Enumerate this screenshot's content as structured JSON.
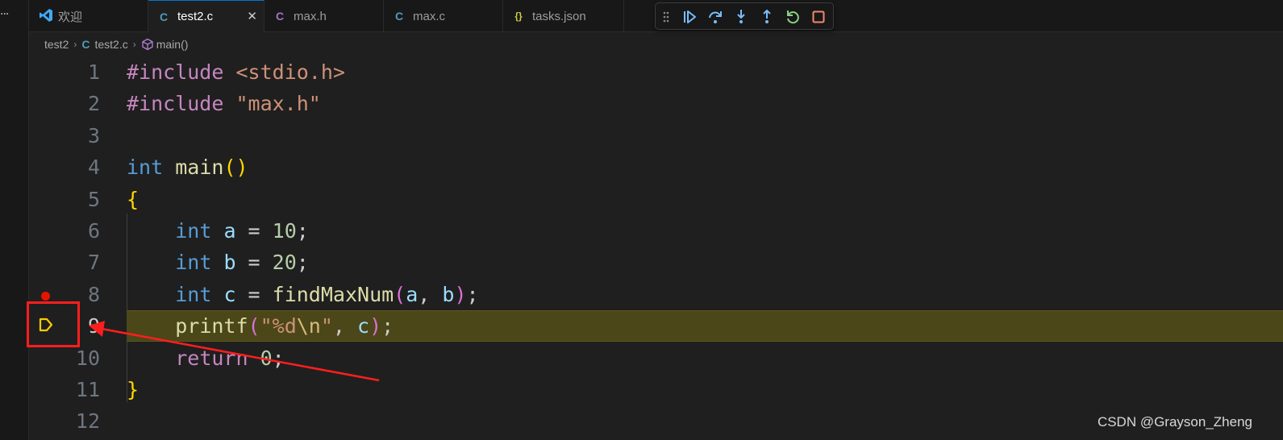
{
  "tabs": [
    {
      "label": "欢迎",
      "icon": "vscode-logo-icon",
      "active": false
    },
    {
      "label": "test2.c",
      "icon": "c-file-icon",
      "glyph": "C",
      "color": "#519aba",
      "active": true,
      "close": "✕"
    },
    {
      "label": "max.h",
      "icon": "c-header-icon",
      "glyph": "C",
      "color": "#a074c4",
      "active": false
    },
    {
      "label": "max.c",
      "icon": "c-file-icon",
      "glyph": "C",
      "color": "#519aba",
      "active": false
    },
    {
      "label": "tasks.json",
      "icon": "json-file-icon",
      "glyph": "{}",
      "color": "#cbcb41",
      "active": false
    }
  ],
  "debug_toolbar": [
    {
      "name": "drag-handle-icon",
      "color": "#8a8a8a"
    },
    {
      "name": "continue-icon",
      "color": "#75beff"
    },
    {
      "name": "step-over-icon",
      "color": "#75beff"
    },
    {
      "name": "step-into-icon",
      "color": "#75beff"
    },
    {
      "name": "step-out-icon",
      "color": "#75beff"
    },
    {
      "name": "restart-icon",
      "color": "#89d185"
    },
    {
      "name": "stop-icon",
      "color": "#f48771"
    }
  ],
  "breadcrumb": {
    "folder": "test2",
    "file": "test2.c",
    "file_glyph": "C",
    "symbol": "main()",
    "sep": "›"
  },
  "editor": {
    "current_line": 9,
    "breakpoint_line": 8,
    "lines": [
      {
        "n": "1",
        "tokens": [
          [
            "k-pre",
            "#include "
          ],
          [
            "k-str",
            "<stdio.h>"
          ]
        ]
      },
      {
        "n": "2",
        "tokens": [
          [
            "k-pre",
            "#include "
          ],
          [
            "k-str",
            "\"max.h\""
          ]
        ]
      },
      {
        "n": "3",
        "tokens": []
      },
      {
        "n": "4",
        "tokens": [
          [
            "k-type",
            "int "
          ],
          [
            "k-fn",
            "main"
          ],
          [
            "k-b1",
            "()"
          ]
        ]
      },
      {
        "n": "5",
        "tokens": [
          [
            "k-b1",
            "{"
          ]
        ]
      },
      {
        "n": "6",
        "tokens": [
          [
            "",
            "    "
          ],
          [
            "k-type",
            "int "
          ],
          [
            "k-var",
            "a"
          ],
          [
            "",
            " = "
          ],
          [
            "k-num",
            "10"
          ],
          [
            "",
            ";"
          ]
        ]
      },
      {
        "n": "7",
        "tokens": [
          [
            "",
            "    "
          ],
          [
            "k-type",
            "int "
          ],
          [
            "k-var",
            "b"
          ],
          [
            "",
            " = "
          ],
          [
            "k-num",
            "20"
          ],
          [
            "",
            ";"
          ]
        ]
      },
      {
        "n": "8",
        "tokens": [
          [
            "",
            "    "
          ],
          [
            "k-type",
            "int "
          ],
          [
            "k-var",
            "c"
          ],
          [
            "",
            " = "
          ],
          [
            "k-fn",
            "findMaxNum"
          ],
          [
            "k-b2",
            "("
          ],
          [
            "k-var",
            "a"
          ],
          [
            "",
            ", "
          ],
          [
            "k-var",
            "b"
          ],
          [
            "k-b2",
            ")"
          ],
          [
            "",
            ";"
          ]
        ]
      },
      {
        "n": "9",
        "tokens": [
          [
            "",
            "    "
          ],
          [
            "k-fn",
            "printf"
          ],
          [
            "k-b2",
            "("
          ],
          [
            "k-str",
            "\"%d"
          ],
          [
            "k-esc",
            "\\n"
          ],
          [
            "k-str",
            "\""
          ],
          [
            "",
            ", "
          ],
          [
            "k-var",
            "c"
          ],
          [
            "k-b2",
            ")"
          ],
          [
            "",
            ";"
          ]
        ]
      },
      {
        "n": "10",
        "tokens": [
          [
            "",
            "    "
          ],
          [
            "k-ctl",
            "return "
          ],
          [
            "k-num",
            "0"
          ],
          [
            "",
            ";"
          ]
        ]
      },
      {
        "n": "11",
        "tokens": [
          [
            "k-b1",
            "}"
          ]
        ]
      },
      {
        "n": "12",
        "tokens": []
      }
    ]
  },
  "annotation": {
    "box_color": "#ff1e1e",
    "arrow_color": "#ff1e1e"
  },
  "watermark": "CSDN @Grayson_Zheng"
}
